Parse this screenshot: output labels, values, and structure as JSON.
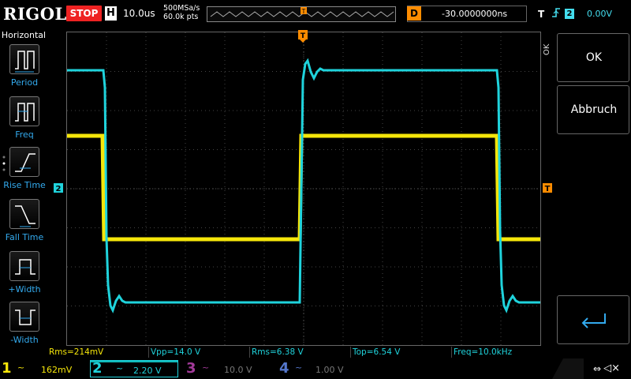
{
  "topbar": {
    "brand": "RIGOL",
    "run_state": "STOP",
    "horizontal_badge": "H",
    "timebase": "10.0us",
    "sample_rate": "500MSa/s",
    "memory_depth": "60.0k pts",
    "trigger_position_marker": "T",
    "delay_badge": "D",
    "delay_value": "-30.0000000ns",
    "trigger_badge": "T",
    "trigger_edge_icon": "rising-edge-icon",
    "trigger_source": "2",
    "trigger_level": "0.00V"
  },
  "left_panel": {
    "title": "Horizontal",
    "items": [
      {
        "label": "Period",
        "icon": "period-icon"
      },
      {
        "label": "Freq",
        "icon": "freq-icon"
      },
      {
        "label": "Rise Time",
        "icon": "rise-time-icon"
      },
      {
        "label": "Fall Time",
        "icon": "fall-time-icon"
      },
      {
        "label": "+Width",
        "icon": "pos-width-icon"
      },
      {
        "label": "-Width",
        "icon": "neg-width-icon"
      }
    ]
  },
  "right_panel": {
    "vertical_label": "OK",
    "buttons": [
      {
        "label": "OK"
      },
      {
        "label": "Abbruch"
      },
      {
        "label": "",
        "icon": "enter-icon"
      }
    ]
  },
  "markers": {
    "ch2_ground": "2",
    "trigger_level": "T",
    "trigger_top": "T"
  },
  "measurements": [
    "Rms=214mV",
    "Vpp=14.0 V",
    "Rms=6.38 V",
    "Top=6.54 V",
    "Freq=10.0kHz"
  ],
  "channels": [
    {
      "num": "1",
      "coupling": "~",
      "scale": "162mV",
      "color": "#f5e60a"
    },
    {
      "num": "2",
      "coupling": "~",
      "scale": "2.20 V",
      "color": "#1fd3dc"
    },
    {
      "num": "3",
      "coupling": "~",
      "scale": "10.0 V",
      "color": "#a33a9a"
    },
    {
      "num": "4",
      "coupling": "~",
      "scale": "1.00 V",
      "color": "#5577cc"
    }
  ],
  "status": {
    "usb_icon": "usb-icon",
    "sound_icon": "speaker-muted-icon"
  },
  "colors": {
    "ch1": "#f5e60a",
    "ch2": "#1fd3dc",
    "stop": "#e22222",
    "trigger": "#ff8c00",
    "accent": "#3aa8e8"
  }
}
